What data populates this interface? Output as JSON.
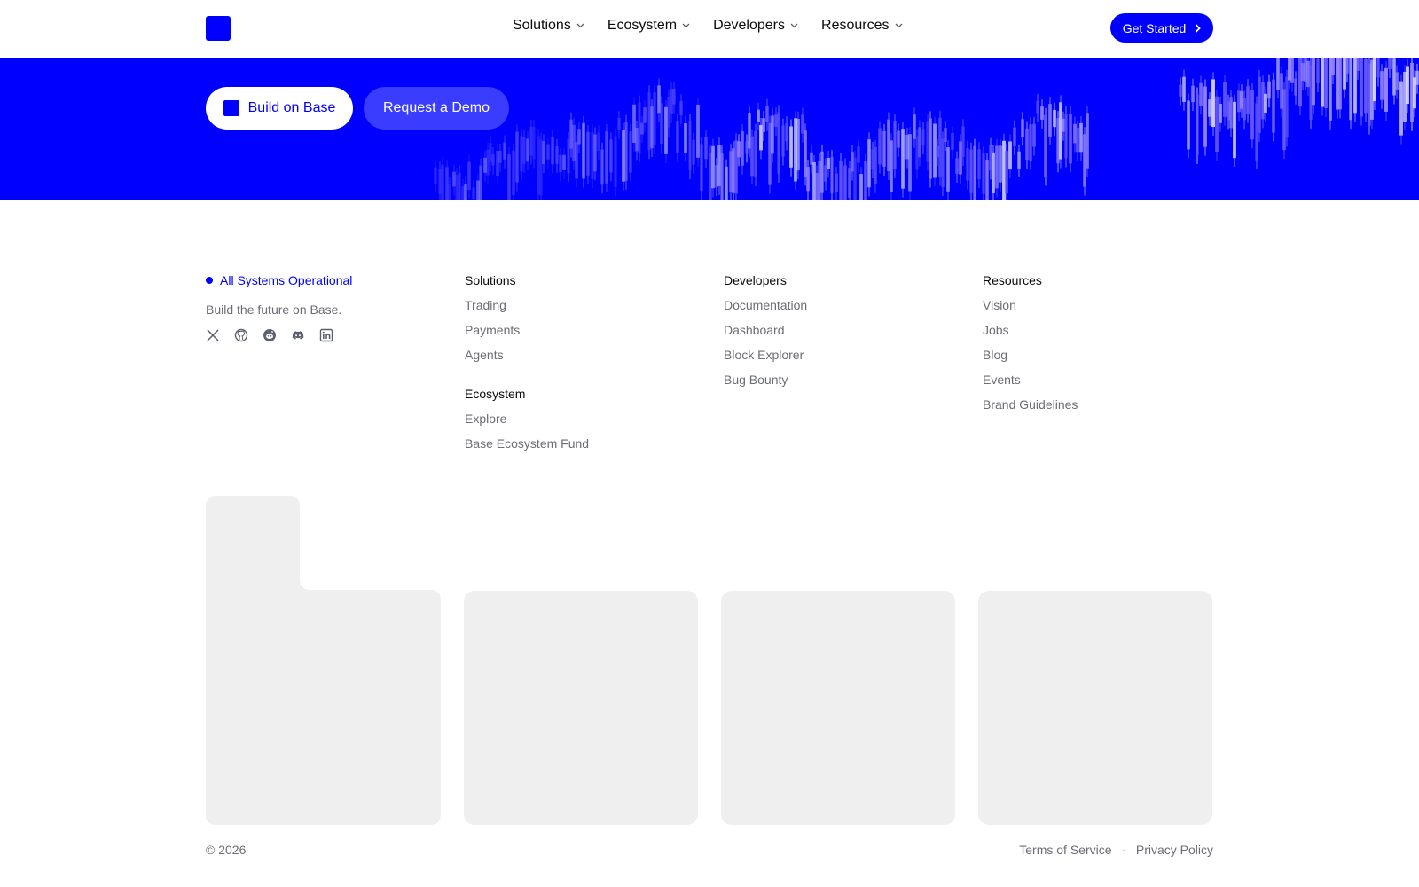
{
  "header": {
    "nav": [
      {
        "label": "Solutions"
      },
      {
        "label": "Ecosystem"
      },
      {
        "label": "Developers"
      },
      {
        "label": "Resources"
      }
    ],
    "cta_label": "Get Started"
  },
  "hero": {
    "build_label": "Build on Base",
    "demo_label": "Request a Demo",
    "accent": "#0000ff"
  },
  "brand": {
    "status": "All Systems Operational",
    "tagline": "Build the future on Base.",
    "socials": [
      "x-icon",
      "github-icon",
      "reddit-icon",
      "discord-icon",
      "linkedin-icon"
    ]
  },
  "columns": {
    "solutions": {
      "title": "Solutions",
      "links": [
        "Trading",
        "Payments",
        "Agents"
      ]
    },
    "ecosystem": {
      "title": "Ecosystem",
      "links": [
        "Explore",
        "Base Ecosystem Fund"
      ]
    },
    "developers": {
      "title": "Developers",
      "links": [
        "Documentation",
        "Dashboard",
        "Block Explorer",
        "Bug Bounty"
      ]
    },
    "resources": {
      "title": "Resources",
      "links": [
        "Vision",
        "Jobs",
        "Blog",
        "Events",
        "Brand Guidelines"
      ]
    }
  },
  "footer": {
    "copyright": "© 2026",
    "terms": "Terms of Service",
    "separator": "·",
    "privacy": "Privacy Policy"
  }
}
